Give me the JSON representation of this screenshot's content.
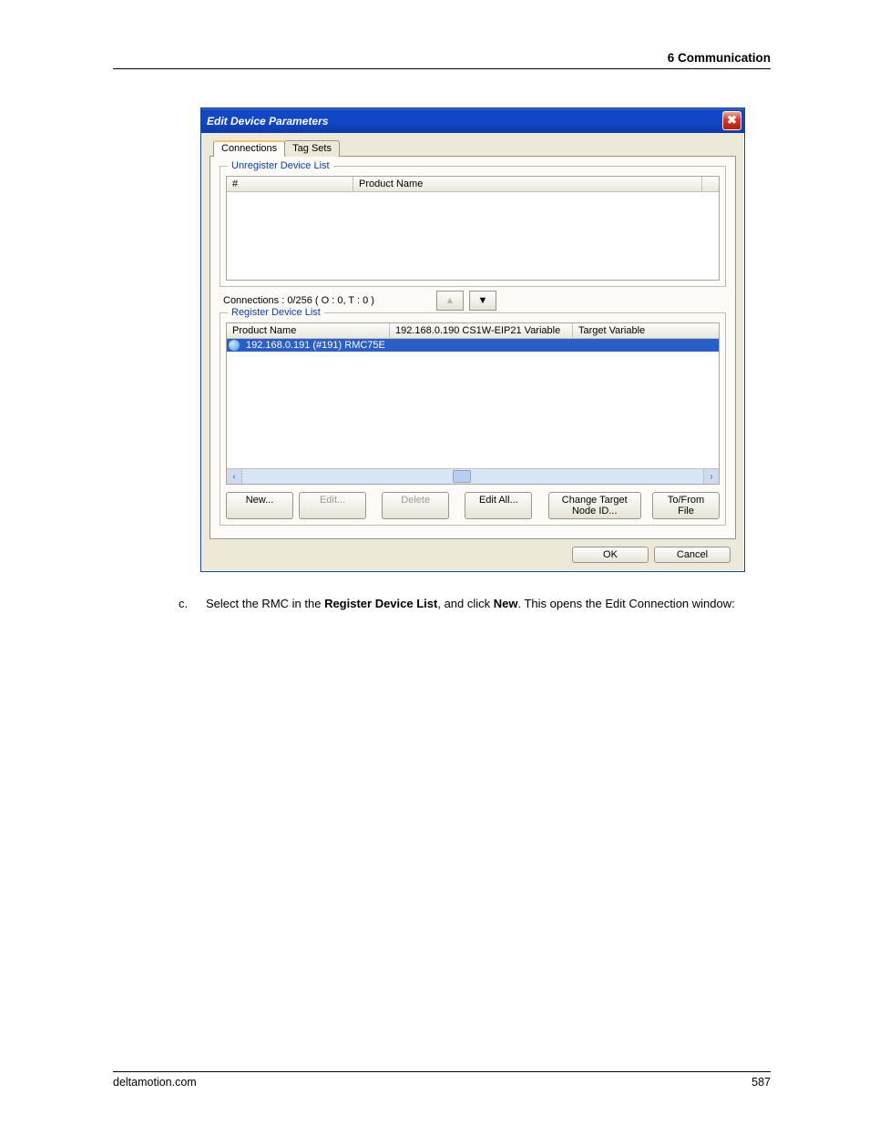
{
  "page": {
    "running_head": "6  Communication",
    "footer_site": "deltamotion.com",
    "page_number": "587"
  },
  "window": {
    "title": "Edit Device Parameters"
  },
  "tabs": [
    {
      "label": "Connections"
    },
    {
      "label": "Tag Sets"
    }
  ],
  "unreg": {
    "group_title": "Unregister Device List",
    "col_hash": "#",
    "col_product": "Product Name"
  },
  "conn_status": "Connections :   0/256 ( O : 0, T : 0 )",
  "reg": {
    "group_title": "Register Device List",
    "col1": "Product Name",
    "col2": "192.168.0.190 CS1W-EIP21 Variable",
    "col3": "Target Variable",
    "row1": "192.168.0.191 (#191) RMC75E"
  },
  "buttons": {
    "new": "New...",
    "edit": "Edit...",
    "delete": "Delete",
    "edit_all": "Edit All...",
    "change_node": "Change Target Node ID...",
    "tofrom": "To/From File",
    "ok": "OK",
    "cancel": "Cancel"
  },
  "instruction": {
    "marker": "c.",
    "pre1": "Select the RMC in the ",
    "bold1": "Register Device List",
    "mid": ", and click ",
    "bold2": "New",
    "post": ". This opens the Edit Connection window:"
  }
}
